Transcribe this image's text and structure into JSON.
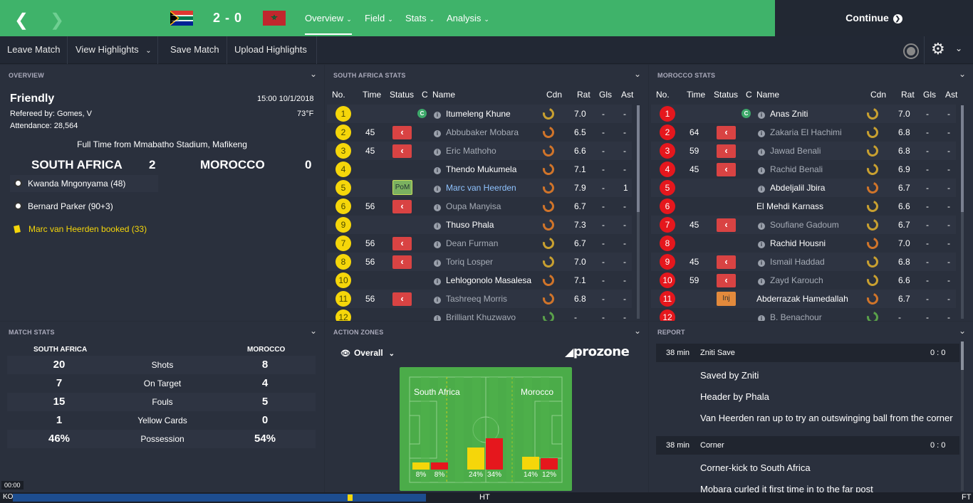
{
  "header": {
    "score": "2 - 0",
    "menus": [
      "Overview",
      "Field",
      "Stats",
      "Analysis"
    ],
    "continue_label": "Continue"
  },
  "toolbar": {
    "leave": "Leave Match",
    "highlights": "View Highlights",
    "save": "Save Match",
    "upload": "Upload Highlights"
  },
  "overview": {
    "title": "OVERVIEW",
    "match_type": "Friendly",
    "datetime": "15:00 10/1/2018",
    "referee": "Refereed by: Gomes, V",
    "temperature": "73°F",
    "attendance": "Attendance: 28,564",
    "venue": "Full Time from Mmabatho Stadium, Mafikeng",
    "home_team": "SOUTH AFRICA",
    "home_score": "2",
    "away_team": "MOROCCO",
    "away_score": "0",
    "events": [
      {
        "text": "Kwanda Mngonyama (48)",
        "type": "goal"
      },
      {
        "text": "Bernard Parker (90+3)",
        "type": "goal"
      },
      {
        "text": "Marc van Heerden booked (33)",
        "type": "yellow"
      }
    ]
  },
  "sa_stats": {
    "title": "SOUTH AFRICA STATS",
    "headers": [
      "No.",
      "Time",
      "Status",
      "C",
      "Name",
      "Cdn",
      "Rat",
      "Gls",
      "Ast"
    ],
    "players": [
      {
        "no": "1",
        "time": "",
        "status": "",
        "cap": true,
        "name": "Itumeleng Khune",
        "rat": "7.0",
        "gls": "-",
        "ast": "-",
        "cdn": "#c8a030",
        "dim": false
      },
      {
        "no": "2",
        "time": "45",
        "status": "sub",
        "name": "Abbubaker Mobara",
        "rat": "6.5",
        "gls": "-",
        "ast": "-",
        "cdn": "#d0742a",
        "dim": true
      },
      {
        "no": "3",
        "time": "45",
        "status": "sub",
        "name": "Eric Mathoho",
        "rat": "6.6",
        "gls": "-",
        "ast": "-",
        "cdn": "#d0742a",
        "dim": true
      },
      {
        "no": "4",
        "time": "",
        "status": "",
        "name": "Thendo Mukumela",
        "rat": "7.1",
        "gls": "-",
        "ast": "-",
        "cdn": "#d0742a",
        "dim": false
      },
      {
        "no": "5",
        "time": "",
        "status": "pom",
        "name": "Marc van Heerden",
        "rat": "7.9",
        "gls": "-",
        "ast": "1",
        "cdn": "#d0742a",
        "dim": false,
        "hl": true
      },
      {
        "no": "6",
        "time": "56",
        "status": "sub",
        "name": "Oupa Manyisa",
        "rat": "6.7",
        "gls": "-",
        "ast": "-",
        "cdn": "#d0742a",
        "dim": true
      },
      {
        "no": "9",
        "time": "",
        "status": "",
        "name": "Thuso Phala",
        "rat": "7.3",
        "gls": "-",
        "ast": "-",
        "cdn": "#d0742a",
        "dim": false
      },
      {
        "no": "7",
        "time": "56",
        "status": "sub",
        "name": "Dean Furman",
        "rat": "6.7",
        "gls": "-",
        "ast": "-",
        "cdn": "#c8a030",
        "dim": true
      },
      {
        "no": "8",
        "time": "56",
        "status": "sub",
        "name": "Toriq Losper",
        "rat": "7.0",
        "gls": "-",
        "ast": "-",
        "cdn": "#c8a030",
        "dim": true
      },
      {
        "no": "10",
        "time": "",
        "status": "",
        "name": "Lehlogonolo Masalesa",
        "rat": "7.1",
        "gls": "-",
        "ast": "-",
        "cdn": "#d0742a",
        "dim": false
      },
      {
        "no": "11",
        "time": "56",
        "status": "sub",
        "name": "Tashreeq Morris",
        "rat": "6.8",
        "gls": "-",
        "ast": "-",
        "cdn": "#d0742a",
        "dim": true
      },
      {
        "no": "12",
        "time": "",
        "status": "",
        "name": "Brilliant Khuzwavo",
        "rat": "-",
        "gls": "-",
        "ast": "-",
        "cdn": "#5aa04a",
        "dim": true
      }
    ]
  },
  "mo_stats": {
    "title": "MOROCCO STATS",
    "headers": [
      "No.",
      "Time",
      "Status",
      "C",
      "Name",
      "Cdn",
      "Rat",
      "Gls",
      "Ast"
    ],
    "players": [
      {
        "no": "1",
        "time": "",
        "status": "",
        "cap": true,
        "name": "Anas Zniti",
        "rat": "7.0",
        "gls": "-",
        "ast": "-",
        "cdn": "#c8a030",
        "dim": false
      },
      {
        "no": "2",
        "time": "64",
        "status": "sub",
        "name": "Zakaria El Hachimi",
        "rat": "6.8",
        "gls": "-",
        "ast": "-",
        "cdn": "#c8a030",
        "dim": true
      },
      {
        "no": "3",
        "time": "59",
        "status": "sub",
        "name": "Jawad Benali",
        "rat": "6.8",
        "gls": "-",
        "ast": "-",
        "cdn": "#c8a030",
        "dim": true
      },
      {
        "no": "4",
        "time": "45",
        "status": "sub",
        "name": "Rachid Benali",
        "rat": "6.9",
        "gls": "-",
        "ast": "-",
        "cdn": "#c8a030",
        "dim": true
      },
      {
        "no": "5",
        "time": "",
        "status": "",
        "name": "Abdeljalil Jbira",
        "rat": "6.7",
        "gls": "-",
        "ast": "-",
        "cdn": "#d0742a",
        "dim": false
      },
      {
        "no": "6",
        "time": "",
        "status": "",
        "name": "El Mehdi Karnass",
        "rat": "6.6",
        "gls": "-",
        "ast": "-",
        "cdn": "#c8a030",
        "dim": false,
        "noinfo": true
      },
      {
        "no": "7",
        "time": "45",
        "status": "sub",
        "name": "Soufiane Gadoum",
        "rat": "6.7",
        "gls": "-",
        "ast": "-",
        "cdn": "#c8a030",
        "dim": true
      },
      {
        "no": "8",
        "time": "",
        "status": "",
        "name": "Rachid Housni",
        "rat": "7.0",
        "gls": "-",
        "ast": "-",
        "cdn": "#d0742a",
        "dim": false
      },
      {
        "no": "9",
        "time": "45",
        "status": "sub",
        "name": "Ismail Haddad",
        "rat": "6.8",
        "gls": "-",
        "ast": "-",
        "cdn": "#c8a030",
        "dim": true
      },
      {
        "no": "10",
        "time": "59",
        "status": "sub",
        "name": "Zayd Karouch",
        "rat": "6.6",
        "gls": "-",
        "ast": "-",
        "cdn": "#c8a030",
        "dim": true
      },
      {
        "no": "11",
        "time": "",
        "status": "inj",
        "name": "Abderrazak Hamedallah",
        "rat": "6.7",
        "gls": "-",
        "ast": "-",
        "cdn": "#d0742a",
        "dim": false,
        "noinfo": true
      },
      {
        "no": "12",
        "time": "",
        "status": "",
        "name": "B. Benachour",
        "rat": "-",
        "gls": "-",
        "ast": "-",
        "cdn": "#5aa04a",
        "dim": true
      }
    ]
  },
  "match_stats": {
    "title": "MATCH STATS",
    "home": "SOUTH AFRICA",
    "away": "MOROCCO",
    "rows": [
      {
        "home": "20",
        "label": "Shots",
        "away": "8"
      },
      {
        "home": "7",
        "label": "On Target",
        "away": "4"
      },
      {
        "home": "15",
        "label": "Fouls",
        "away": "5"
      },
      {
        "home": "1",
        "label": "Yellow Cards",
        "away": "0"
      },
      {
        "home": "46%",
        "label": "Possession",
        "away": "54%"
      }
    ]
  },
  "action_zones": {
    "title": "ACTION ZONES",
    "view": "Overall",
    "brand": "prozone",
    "home_label": "South Africa",
    "away_label": "Morocco",
    "zones": [
      {
        "home": 8,
        "away": 8,
        "home_label": "8%",
        "away_label": "8%"
      },
      {
        "home": 24,
        "away": 34,
        "home_label": "24%",
        "away_label": "34%"
      },
      {
        "home": 14,
        "away": 12,
        "home_label": "14%",
        "away_label": "12%"
      }
    ]
  },
  "report": {
    "title": "REPORT",
    "entries": [
      {
        "time": "38 min",
        "event": "Zniti Save",
        "score": "0 : 0",
        "lines": [
          "Saved by Zniti",
          "Header by Phala",
          "Van Heerden ran up to try an outswinging ball from the corner"
        ]
      },
      {
        "time": "38 min",
        "event": "Corner",
        "score": "0 : 0",
        "lines": [
          "Corner-kick to South Africa",
          "Mobara curled it first time in to the far post"
        ]
      }
    ]
  },
  "timeline": {
    "start": "00:00",
    "ko": "KO",
    "ht": "HT",
    "ft": "FT"
  },
  "colors": {
    "green": "#3fb36a",
    "yellow": "#f5d60a",
    "red": "#e5171d"
  }
}
